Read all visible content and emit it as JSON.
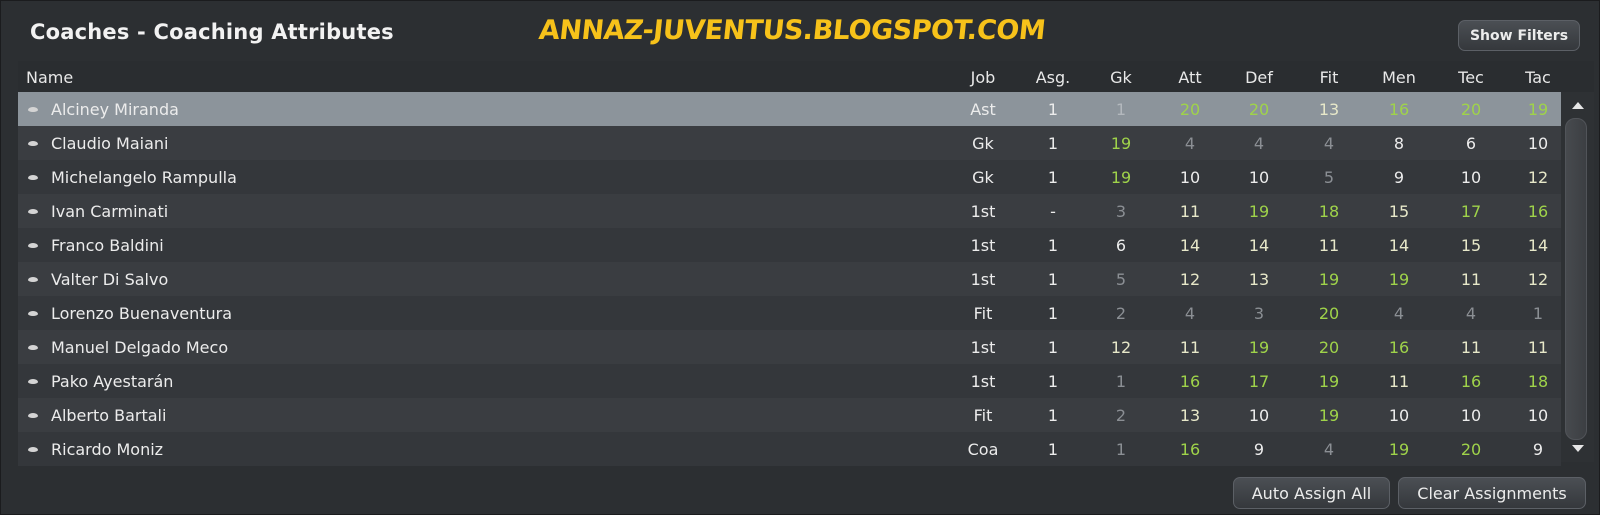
{
  "title": "Coaches - Coaching Attributes",
  "watermark": "ANNAZ-JUVENTUS.BLOGSPOT.COM",
  "buttons": {
    "show_filters": "Show Filters",
    "auto_assign_all": "Auto Assign All",
    "clear_assignments": "Clear Assignments"
  },
  "columns": {
    "name": "Name",
    "job": "Job",
    "asg": "Asg.",
    "gk": "Gk",
    "att": "Att",
    "def": "Def",
    "fit": "Fit",
    "men": "Men",
    "tec": "Tec",
    "tac": "Tac"
  },
  "colors": {
    "green": "#9fd34a",
    "light": "#e7e8c9",
    "white": "#ececec",
    "gray": "#8b8f94",
    "selected_row": "#8c949b"
  },
  "rows": [
    {
      "name": "Alciney Miranda",
      "job": "Ast",
      "asg": "1",
      "gk": "1",
      "att": "20",
      "def": "20",
      "fit": "13",
      "men": "16",
      "tec": "20",
      "tac": "19",
      "selected": true
    },
    {
      "name": "Claudio Maiani",
      "job": "Gk",
      "asg": "1",
      "gk": "19",
      "att": "4",
      "def": "4",
      "fit": "4",
      "men": "8",
      "tec": "6",
      "tac": "10"
    },
    {
      "name": "Michelangelo Rampulla",
      "job": "Gk",
      "asg": "1",
      "gk": "19",
      "att": "10",
      "def": "10",
      "fit": "5",
      "men": "9",
      "tec": "10",
      "tac": "12"
    },
    {
      "name": "Ivan Carminati",
      "job": "1st",
      "asg": "-",
      "gk": "3",
      "att": "11",
      "def": "19",
      "fit": "18",
      "men": "15",
      "tec": "17",
      "tac": "16"
    },
    {
      "name": "Franco Baldini",
      "job": "1st",
      "asg": "1",
      "gk": "6",
      "att": "14",
      "def": "14",
      "fit": "11",
      "men": "14",
      "tec": "15",
      "tac": "14"
    },
    {
      "name": "Valter Di Salvo",
      "job": "1st",
      "asg": "1",
      "gk": "5",
      "att": "12",
      "def": "13",
      "fit": "19",
      "men": "19",
      "tec": "11",
      "tac": "12"
    },
    {
      "name": "Lorenzo Buenaventura",
      "job": "Fit",
      "asg": "1",
      "gk": "2",
      "att": "4",
      "def": "3",
      "fit": "20",
      "men": "4",
      "tec": "4",
      "tac": "1"
    },
    {
      "name": "Manuel Delgado Meco",
      "job": "1st",
      "asg": "1",
      "gk": "12",
      "att": "11",
      "def": "19",
      "fit": "20",
      "men": "16",
      "tec": "11",
      "tac": "11"
    },
    {
      "name": "Pako Ayestarán",
      "job": "1st",
      "asg": "1",
      "gk": "1",
      "att": "16",
      "def": "17",
      "fit": "19",
      "men": "11",
      "tec": "16",
      "tac": "18"
    },
    {
      "name": "Alberto Bartali",
      "job": "Fit",
      "asg": "1",
      "gk": "2",
      "att": "13",
      "def": "10",
      "fit": "19",
      "men": "10",
      "tec": "10",
      "tac": "10"
    },
    {
      "name": "Ricardo Moniz",
      "job": "Coa",
      "asg": "1",
      "gk": "1",
      "att": "16",
      "def": "9",
      "fit": "4",
      "men": "19",
      "tec": "20",
      "tac": "9"
    }
  ]
}
